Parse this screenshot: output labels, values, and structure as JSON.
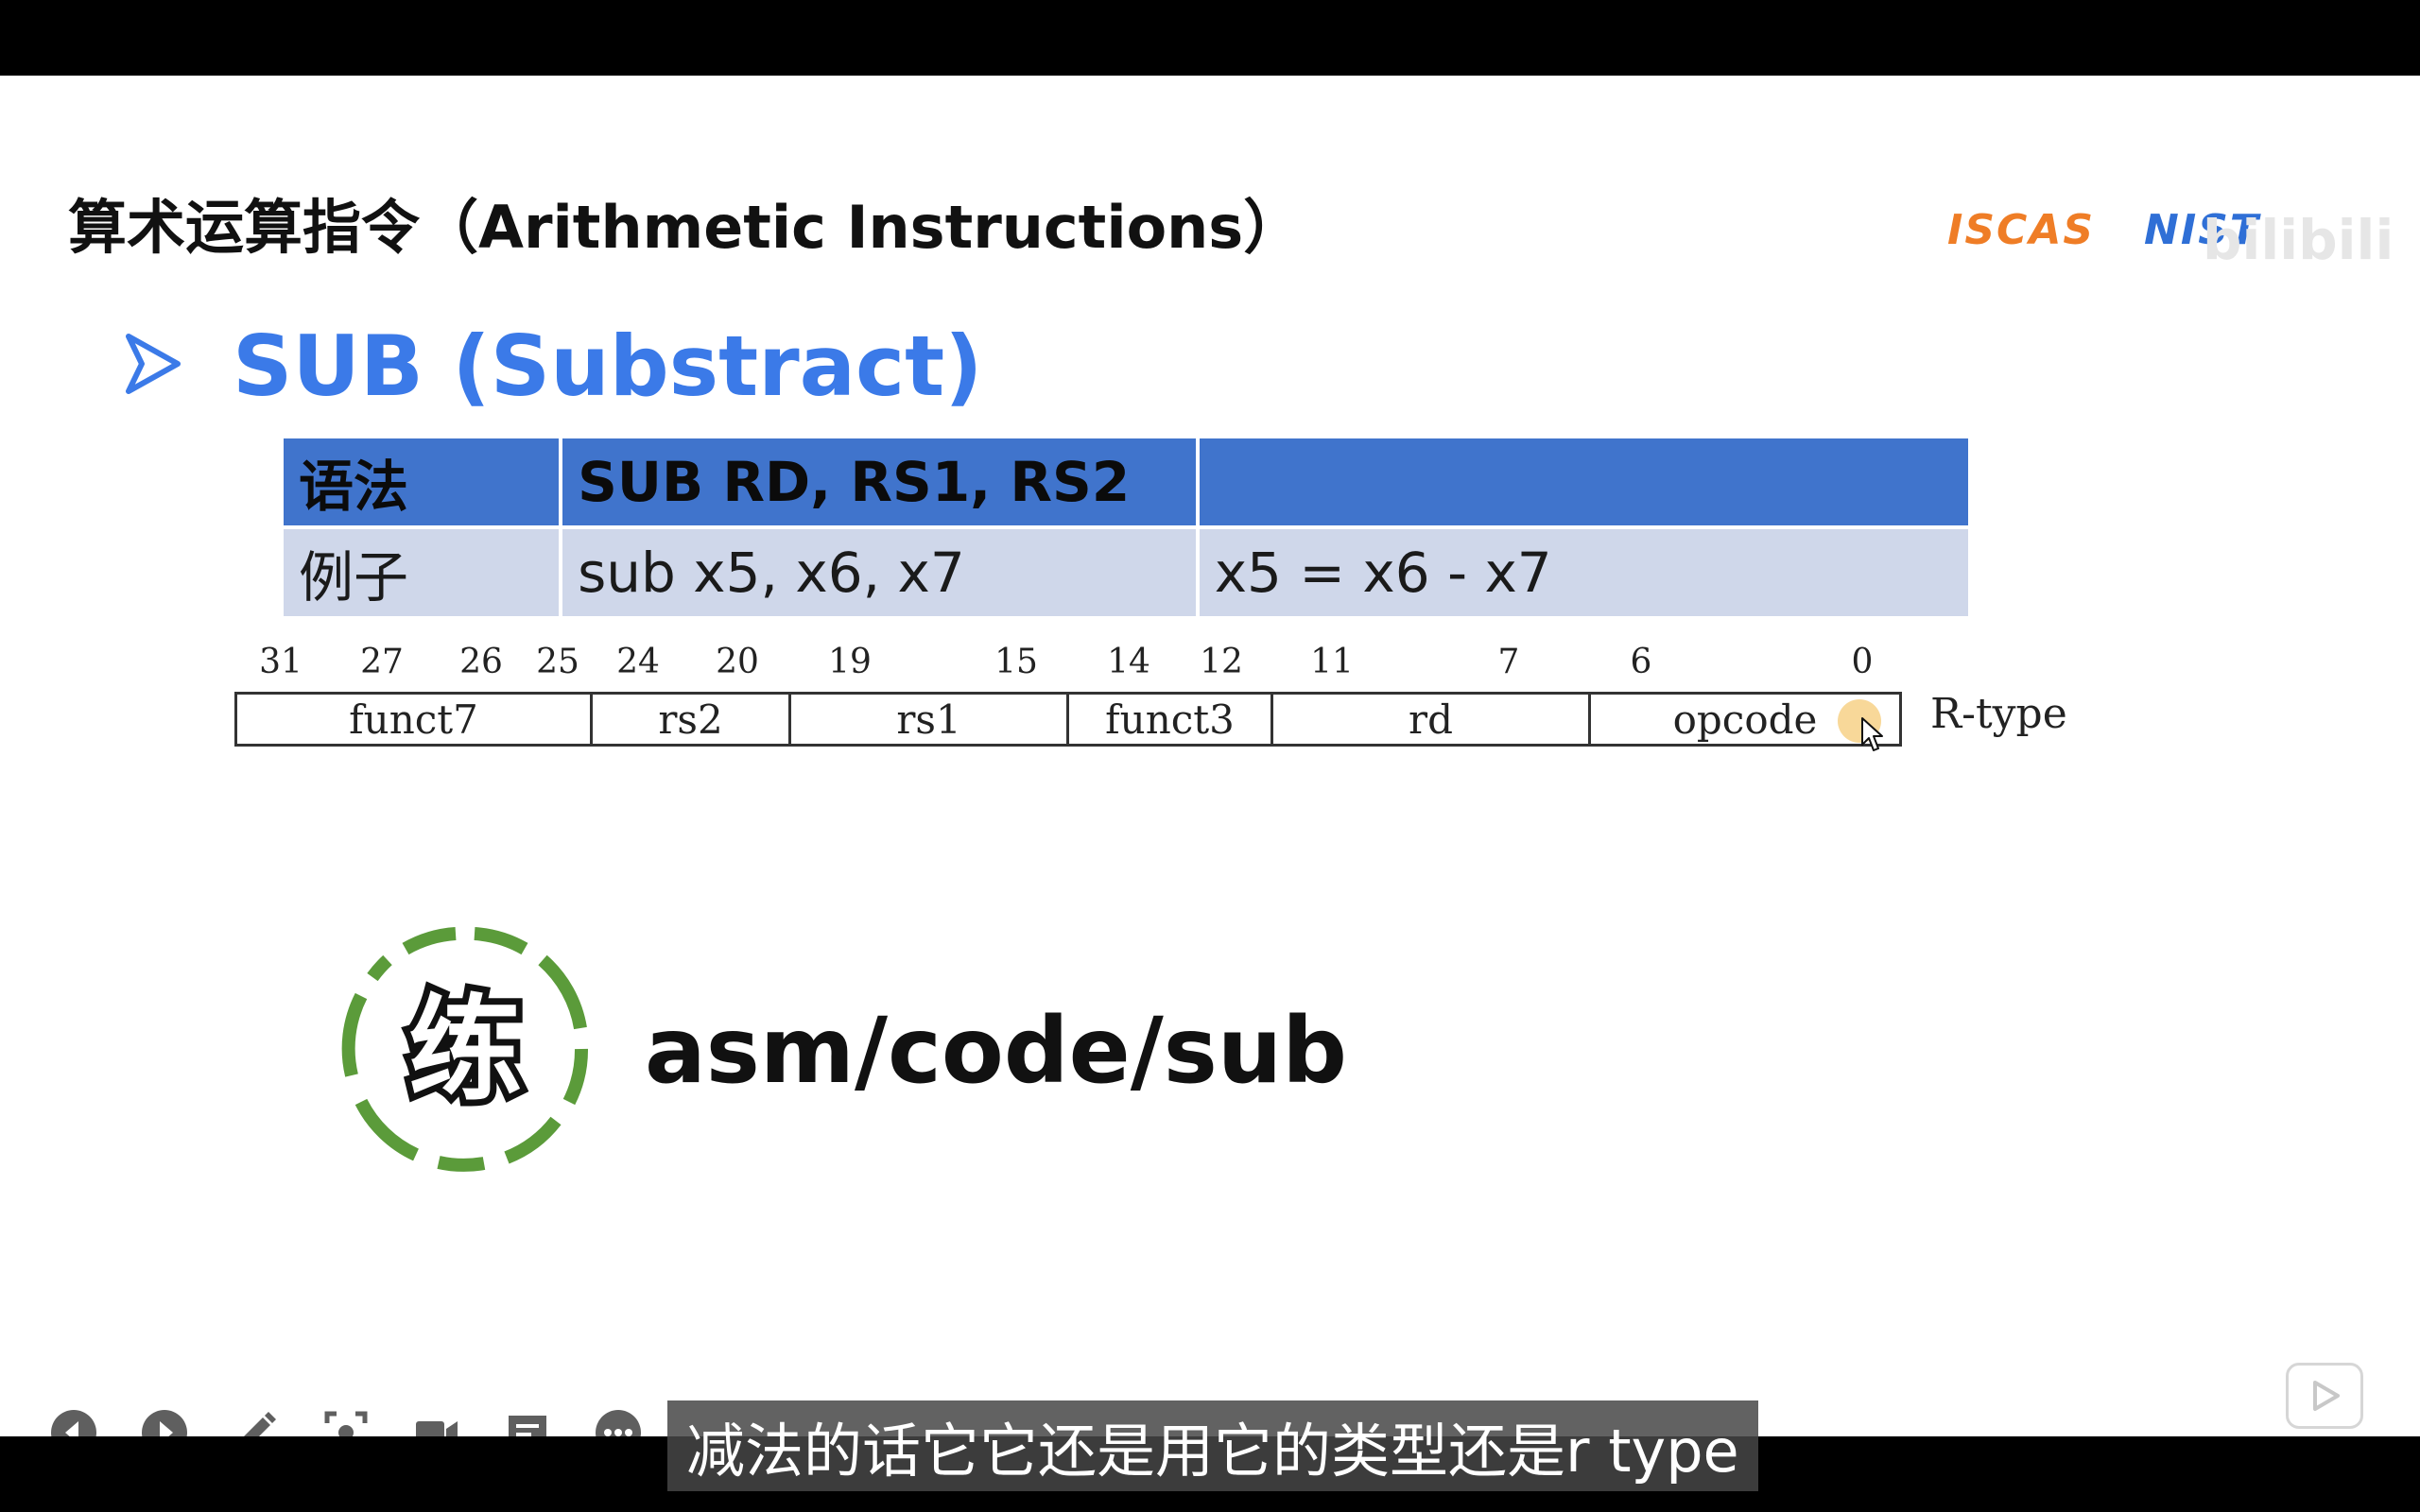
{
  "slide": {
    "title": "算术运算指令（Arithmetic Instructions）",
    "logos": {
      "iscas": "ISCAS",
      "nist": "NIST",
      "watermark": "bilibili"
    },
    "heading": "SUB (Substract)",
    "syntax_table": {
      "header": [
        "语法",
        "SUB RD, RS1, RS2",
        ""
      ],
      "example": [
        "例子",
        "sub x5, x6, x7",
        "x5 = x6 - x7"
      ]
    },
    "rtype": {
      "bit_numbers": [
        "31",
        "27",
        "26",
        "25",
        "24",
        "20",
        "19",
        "15",
        "14",
        "12",
        "11",
        "7",
        "6",
        "0"
      ],
      "fields": [
        "funct7",
        "rs2",
        "rs1",
        "funct3",
        "rd",
        "opcode"
      ],
      "type_label": "R-type"
    },
    "practice": {
      "icon_char": "练",
      "path": "asm/code/sub",
      "ring_color": "#5b9b3a"
    }
  },
  "toolbar": {
    "items": [
      "prev-icon",
      "next-icon",
      "pen-icon",
      "screenshot-icon",
      "camera-icon",
      "comment-icon",
      "more-icon"
    ]
  },
  "player": {
    "subtitle": "减法的话它它还是用它的类型还是r type"
  },
  "colors": {
    "heading": "#3b7ae8",
    "table_header": "#4074cc",
    "table_row": "#cfd7ea",
    "iscas": "#ef7d26",
    "nist": "#2f6fd6"
  }
}
